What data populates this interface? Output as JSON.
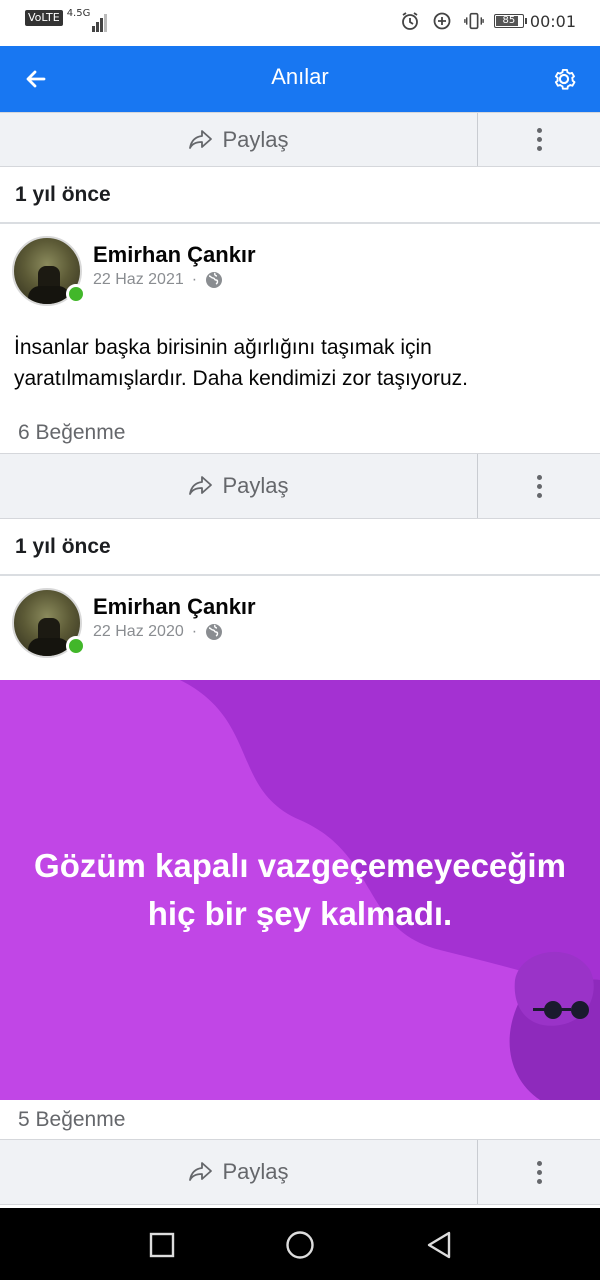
{
  "status_bar": {
    "volte": "VoLTE",
    "network": "4.5G",
    "battery": "85",
    "time": "00:01"
  },
  "app_bar": {
    "title": "Anılar",
    "back_icon": "arrow-left-icon",
    "settings_icon": "gear-icon",
    "color": "#1877f2"
  },
  "actions": {
    "share_label": "Paylaş",
    "more_icon": "three-dots-vertical-icon"
  },
  "memories": [
    {
      "header": "1 yıl önce",
      "author": "Emirhan Çankır",
      "date": "22 Haz 2021",
      "visibility_icon": "globe-icon",
      "text": "İnsanlar başka birisinin ağırlığını taşımak için yaratılmamışlardır. Daha kendimizi zor taşıyoruz.",
      "likes": "6 Beğenme"
    },
    {
      "header": "1 yıl önce",
      "author": "Emirhan Çankır",
      "date": "22 Haz 2020",
      "visibility_icon": "globe-icon",
      "banner_text": "Gözüm kapalı vazgeçemeyeceğim hiç bir şey kalmadı.",
      "banner_color": "#b539e0",
      "likes": "5 Beğenme"
    }
  ],
  "nav_bar": {
    "recents_icon": "square-icon",
    "home_icon": "circle-icon",
    "back_icon": "triangle-back-icon"
  }
}
